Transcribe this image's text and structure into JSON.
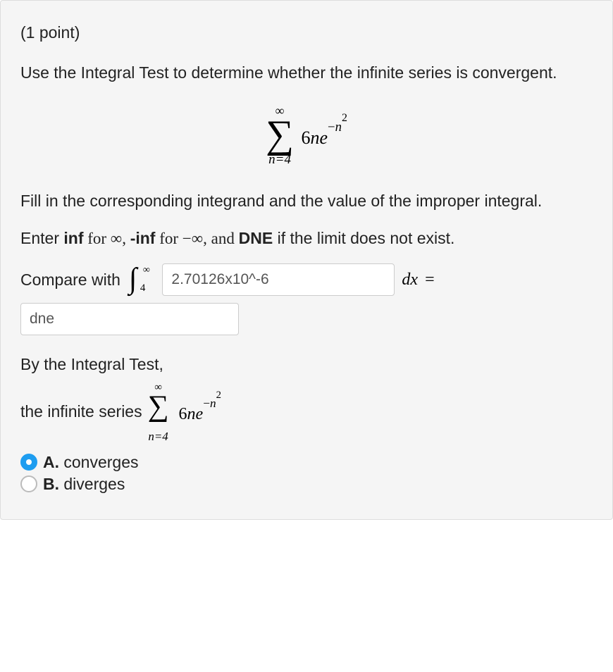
{
  "points_label": "(1 point)",
  "prompt_1": "Use the Integral Test to determine whether the infinite series is convergent.",
  "series": {
    "upper": "∞",
    "lower": "n=4",
    "coef": "6",
    "var": "n",
    "fn": "e",
    "exp_sign": "−",
    "exp_var": "n",
    "exp_pow": "2"
  },
  "instr_1": "Fill in the corresponding integrand and the value of the improper integral.",
  "instr_2a": "Enter ",
  "instr_inf": "inf",
  "instr_2b": " for ∞, ",
  "instr_ninf": "-inf",
  "instr_2c": " for −∞, and ",
  "instr_dne": "DNE",
  "instr_2d": " if the limit does not exist.",
  "compare_label": "Compare with ",
  "integral": {
    "upper": "∞",
    "lower": "4"
  },
  "input_integrand": "2.70126x10^-6",
  "dx_label": "dx",
  "eq_label": " =",
  "input_result": "dne",
  "conclude_1": "By the Integral Test,",
  "conclude_2": "the infinite series ",
  "options": {
    "a_letter": "A.",
    "a_text": " converges",
    "b_letter": "B.",
    "b_text": " diverges"
  }
}
